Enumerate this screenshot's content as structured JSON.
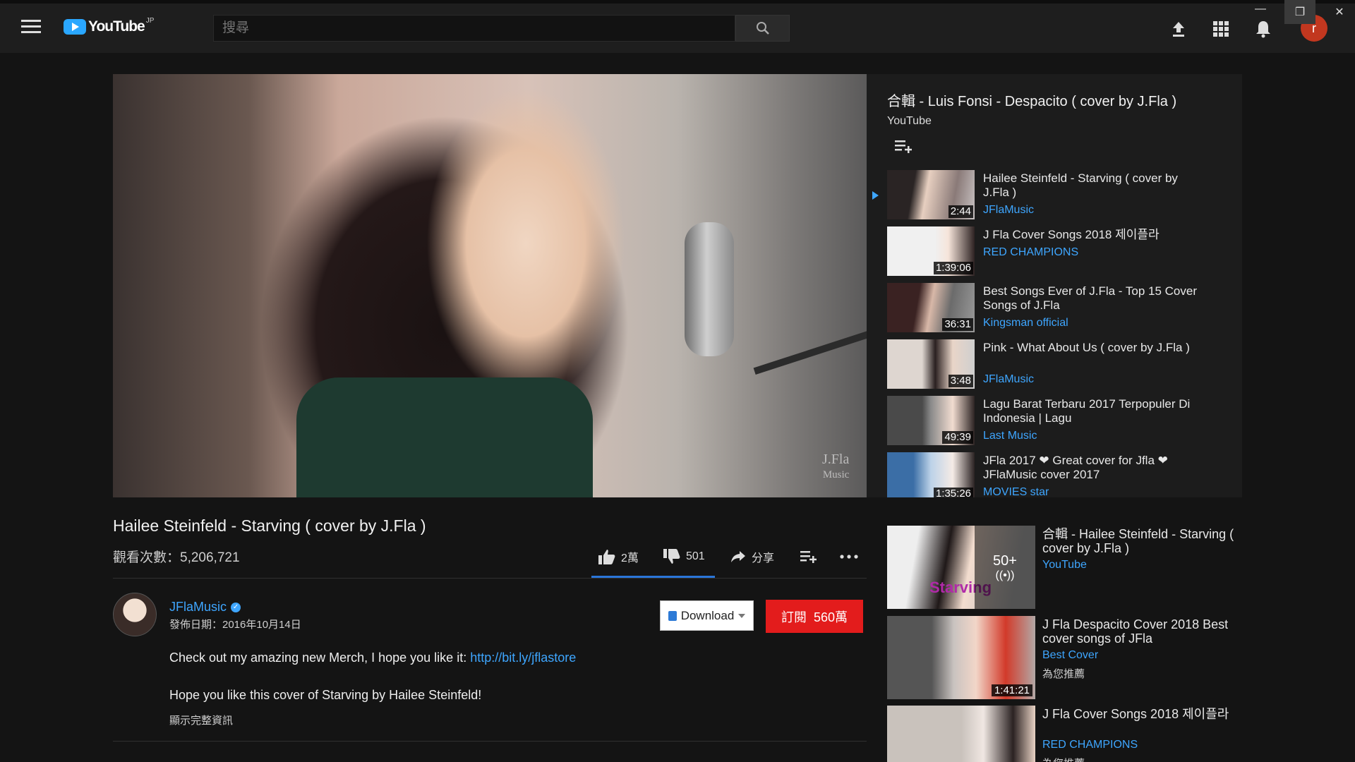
{
  "header": {
    "logo_text": "YouTube",
    "logo_region": "JP",
    "search_placeholder": "搜尋"
  },
  "video": {
    "watermark_line1": "J.Fla",
    "watermark_line2": "Music",
    "title": "Hailee Steinfeld - Starving ( cover by J.Fla )",
    "views": "觀看次數：5,206,721",
    "likes": "2萬",
    "dislikes": "501",
    "share_label": "分享",
    "like_ratio": 0.97
  },
  "channel": {
    "name": "JFlaMusic",
    "published": "發佈日期：2016年10月14日",
    "download_label": "Download",
    "subscribe_label": "訂閱",
    "subscriber_count": "560萬"
  },
  "description": {
    "line1_text": "Check out my amazing new Merch, I hope you like it: ",
    "line1_link": "http://bit.ly/jflastore",
    "line2": "Hope you like this cover of Starving by Hailee Steinfeld!",
    "show_more": "顯示完整資訊"
  },
  "playlist": {
    "title": "合輯 - Luis Fonsi - Despacito ( cover by J.Fla )",
    "owner": "YouTube",
    "items": [
      {
        "title": "Hailee Steinfeld - Starving ( cover by J.Fla )",
        "channel": "JFlaMusic",
        "duration": "2:44",
        "current": true
      },
      {
        "title": "J Fla Cover Songs 2018 제이플라",
        "channel": "RED CHAMPIONS",
        "duration": "1:39:06"
      },
      {
        "title": "Best Songs Ever of J.Fla - Top 15 Cover Songs of J.Fla",
        "channel": "Kingsman official",
        "duration": "36:31"
      },
      {
        "title": "Pink - What About Us ( cover by J.Fla )",
        "channel": "JFlaMusic",
        "duration": "3:48"
      },
      {
        "title": "Lagu Barat Terbaru 2017 Terpopuler Di Indonesia | Lagu",
        "channel": "Last Music",
        "duration": "49:39"
      },
      {
        "title": "JFla 2017 ❤ Great cover for Jfla ❤ JFlaMusic cover 2017",
        "channel": "MOVIES star",
        "duration": "1:35:26"
      }
    ]
  },
  "recommendations": [
    {
      "title": "合輯 - Hailee Steinfeld - Starving ( cover by J.Fla )",
      "channel": "YouTube",
      "mix_count": "50+",
      "thumb_text": "Starving"
    },
    {
      "title": "J Fla Despacito Cover 2018 Best cover songs of JFla",
      "channel": "Best Cover",
      "note": "為您推薦",
      "duration": "1:41:21"
    },
    {
      "title": "J Fla Cover Songs 2018 제이플라",
      "channel": "RED CHAMPIONS",
      "note": "為您推薦"
    }
  ],
  "icons": {
    "menu": "hamburger-icon",
    "search": "search-icon",
    "upload": "upload-icon",
    "apps": "apps-grid-icon",
    "notifications": "bell-icon",
    "avatar_letter": "r"
  },
  "colors": {
    "accent_blue": "#3ea6ff",
    "subscribe_red": "#e31c1c",
    "background": "#141414"
  }
}
